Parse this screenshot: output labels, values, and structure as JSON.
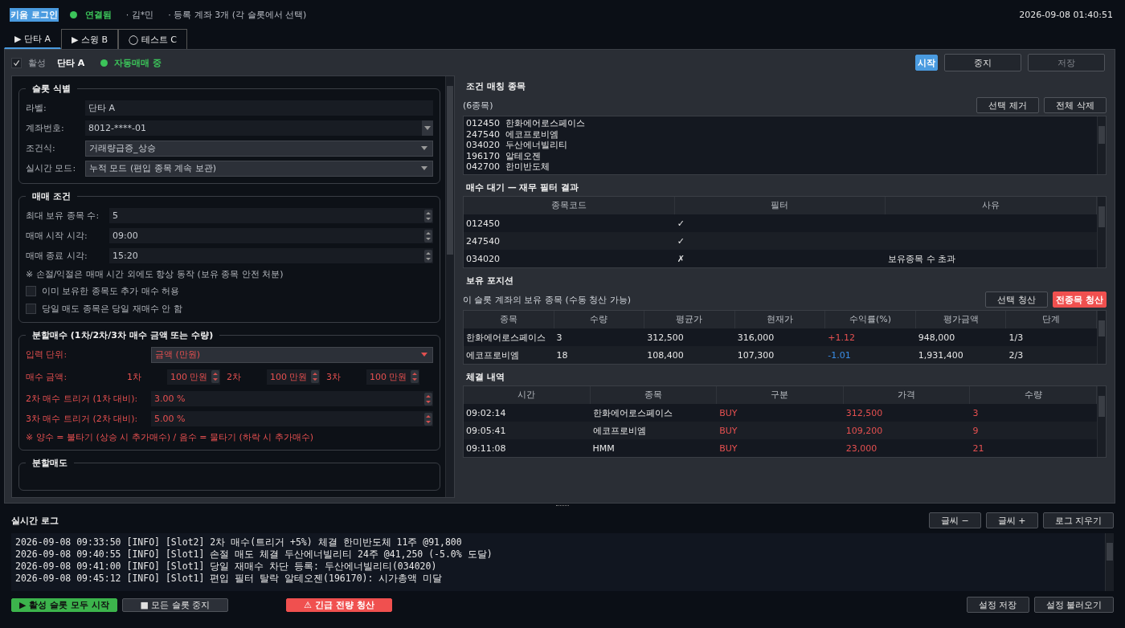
{
  "header": {
    "login_button": "키움 로그인",
    "connected": true,
    "connection": "연결됨",
    "user": "· 김*민",
    "accounts": "· 등록 계좌 3개 (각 슬롯에서 선택)",
    "datetime": "2026-09-08  01:40:51"
  },
  "tabs": [
    {
      "label": "▶ 단타 A",
      "selected": true
    },
    {
      "label": "▶ 스윙 B",
      "selected": false
    },
    {
      "label": "◯ 테스트 C",
      "selected": false
    }
  ],
  "slot": {
    "active_label": "활성",
    "active": true,
    "name": "단타 A",
    "running": true,
    "status": "자동매매 중",
    "buttons": [
      {
        "label": "시작",
        "kind": "primary"
      },
      {
        "label": "중지",
        "kind": "normal"
      },
      {
        "label": "저장",
        "kind": "disabled"
      }
    ]
  },
  "identity": {
    "title": "슬롯 식별",
    "fields": [
      {
        "label": "라벨:",
        "value": "단타 A",
        "kind": "text"
      },
      {
        "label": "계좌번호:",
        "value": "8012-****-01",
        "kind": "combo_edit"
      },
      {
        "label": "조건식:",
        "value": "거래량급증_상승",
        "kind": "combo"
      },
      {
        "label": "실시간 모드:",
        "value": "누적 모드 (편입 종목 계속 보관)",
        "kind": "combo"
      }
    ]
  },
  "conditions": {
    "title": "매매 조건",
    "fields": [
      {
        "label": "최대 보유 종목 수:",
        "value": "5"
      },
      {
        "label": "매매 시작 시각:",
        "value": "09:00"
      },
      {
        "label": "매매 종료 시각:",
        "value": "15:20"
      }
    ],
    "note": "※ 손절/익절은 매매 시간 외에도 항상 동작 (보유 종목 안전 처분)",
    "options": [
      {
        "label": "이미 보유한 종목도 추가 매수 허용",
        "checked": false
      },
      {
        "label": "당일 매도 종목은 당일 재매수 안 함",
        "checked": false
      }
    ]
  },
  "split_buy": {
    "title": "분할매수 (1차/2차/3차 매수 금액 또는 수량)",
    "unit_label": "입력 단위:",
    "unit": "금액 (만원)",
    "amount_label": "매수 금액:",
    "amounts": [
      {
        "label": "1차",
        "value": "100 만원"
      },
      {
        "label": "2차",
        "value": "100 만원"
      },
      {
        "label": "3차",
        "value": "100 만원"
      }
    ],
    "triggers": [
      {
        "label": "2차 매수 트리거 (1차 대비):",
        "value": "3.00 %"
      },
      {
        "label": "3차 매수 트리거 (2차 대비):",
        "value": "5.00 %"
      }
    ],
    "note": "※ 양수 = 불타기 (상승 시 추가매수) / 음수 = 물타기 (하락 시 추가매수)"
  },
  "split_sell": {
    "title": "분할매도"
  },
  "matched": {
    "title": "조건 매칭 종목",
    "count": "(6종목)",
    "buttons": [
      "선택 제거",
      "전체 삭제"
    ],
    "items": [
      "012450  한화에어로스페이스",
      "247540  에코프로비엠",
      "034020  두산에너빌리티",
      "196170  알테오젠",
      "042700  한미반도체"
    ]
  },
  "filter": {
    "title": "매수 대기 — 재무 필터 결과",
    "columns": [
      "종목코드",
      "필터",
      "사유"
    ],
    "rows": [
      {
        "code": "012450",
        "mark": "✓"
      },
      {
        "code": "247540",
        "mark": "✓"
      },
      {
        "code": "034020",
        "mark": "✗",
        "reason": "보유종목 수 초과"
      }
    ]
  },
  "positions": {
    "title": "보유 포지션",
    "subtitle": "이 슬롯 계좌의 보유 종목 (수동 청산 가능)",
    "buttons": [
      {
        "label": "선택 청산",
        "kind": "normal"
      },
      {
        "label": "전종목 청산",
        "kind": "danger"
      }
    ],
    "columns": [
      "종목",
      "수량",
      "평균가",
      "현재가",
      "수익률(%)",
      "평가금액",
      "단계"
    ],
    "rows": [
      {
        "cells": [
          "한화에어로스페이스",
          "3",
          "312,500",
          "316,000",
          "+1.12",
          "948,000",
          "1/3"
        ],
        "kind": "gain"
      },
      {
        "cells": [
          "에코프로비엠",
          "18",
          "108,400",
          "107,300",
          "-1.01",
          "1,931,400",
          "2/3"
        ],
        "kind": "loss"
      }
    ]
  },
  "executions": {
    "title": "체결 내역",
    "columns": [
      "시간",
      "종목",
      "구분",
      "가격",
      "수량"
    ],
    "rows": [
      {
        "cells": [
          "09:02:14",
          "한화에어로스페이스",
          "BUY",
          "312,500",
          "3"
        ],
        "kind": "buy"
      },
      {
        "cells": [
          "09:05:41",
          "에코프로비엠",
          "BUY",
          "109,200",
          "9"
        ],
        "kind": "buy"
      },
      {
        "cells": [
          "09:11:08",
          "HMM",
          "BUY",
          "23,000",
          "21"
        ],
        "kind": "buy"
      }
    ]
  },
  "log": {
    "title": "실시간 로그",
    "buttons": [
      "글씨 −",
      "글씨 +",
      "로그 지우기"
    ],
    "lines": [
      "2026-09-08 09:33:50 [INFO] [Slot2] 2차 매수(트리거 +5%) 체결 한미반도체 11주 @91,800",
      "2026-09-08 09:40:55 [INFO] [Slot1] 손절 매도 체결 두산에너빌리티 24주 @41,250 (-5.0% 도달)",
      "2026-09-08 09:41:00 [INFO] [Slot1] 당일 재매수 차단 등록: 두산에너빌리티(034020)",
      "2026-09-08 09:45:12 [INFO] [Slot1] 편입 필터 탈락 알테오젠(196170): 시가총액 미달"
    ]
  },
  "footer": {
    "buttons": [
      {
        "label": "▶ 활성 슬롯 모두 시작",
        "kind": "start"
      },
      {
        "label": "■ 모든 슬롯 중지",
        "kind": "stop"
      },
      {
        "label": "⚠ 긴급 전량 청산",
        "kind": "danger"
      }
    ],
    "right_buttons": [
      "설정 저장",
      "설정 불러오기"
    ]
  }
}
